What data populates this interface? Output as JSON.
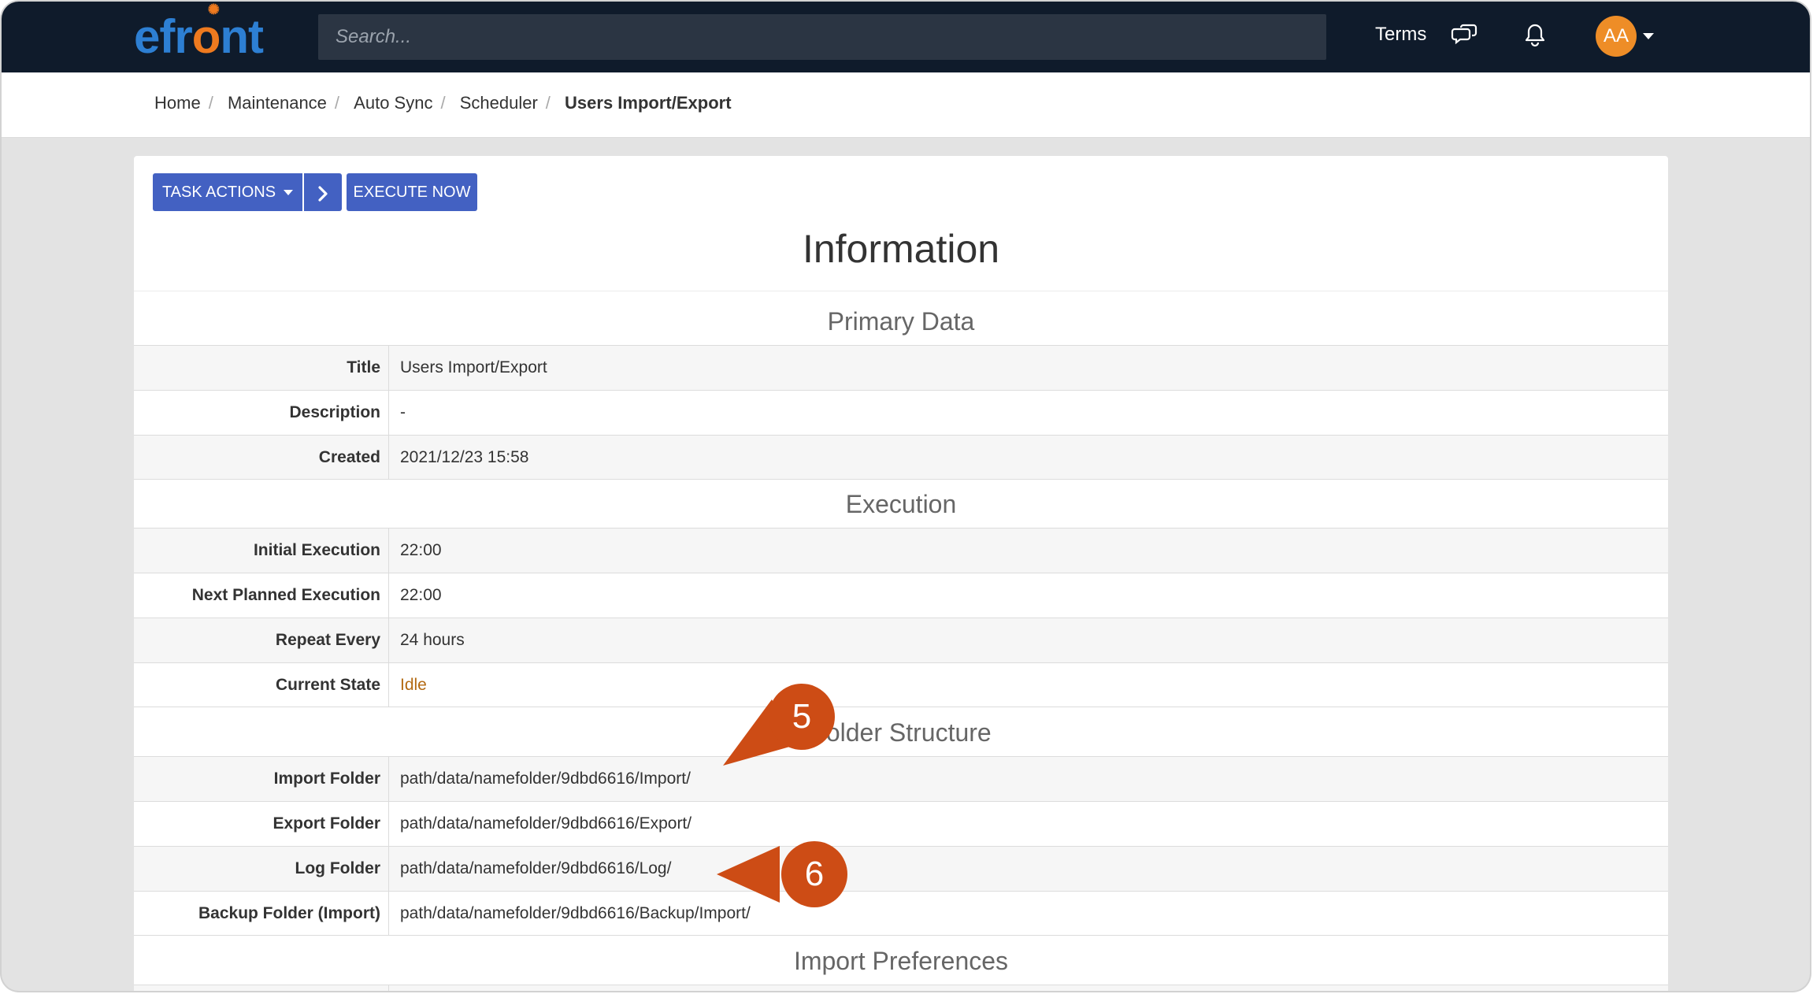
{
  "header": {
    "logo": "efront",
    "search_placeholder": "Search...",
    "terms_label": "Terms",
    "chat_icon": "chat-bubbles-icon",
    "bell_icon": "bell-icon",
    "avatar_initials": "AA"
  },
  "breadcrumb": [
    "Home",
    "Maintenance",
    "Auto Sync",
    "Scheduler",
    "Users Import/Export"
  ],
  "toolbar": {
    "task_actions_label": "TASK ACTIONS",
    "next_label": "›",
    "execute_now_label": "EXECUTE NOW"
  },
  "page_title": "Information",
  "sections": {
    "primary": {
      "heading": "Primary Data",
      "rows": [
        {
          "label": "Title",
          "value": "Users Import/Export"
        },
        {
          "label": "Description",
          "value": "-"
        },
        {
          "label": "Created",
          "value": "2021/12/23 15:58"
        }
      ]
    },
    "execution": {
      "heading": "Execution",
      "rows": [
        {
          "label": "Initial Execution",
          "value": "22:00"
        },
        {
          "label": "Next Planned Execution",
          "value": "22:00"
        },
        {
          "label": "Repeat Every",
          "value": "24 hours"
        },
        {
          "label": "Current State",
          "value": "Idle"
        }
      ]
    },
    "folders": {
      "heading": "Folder Structure",
      "rows": [
        {
          "label": "Import Folder",
          "value": "path/data/namefolder/9dbd6616/Import/"
        },
        {
          "label": "Export Folder",
          "value": "path/data/namefolder/9dbd6616/Export/"
        },
        {
          "label": "Log Folder",
          "value": "path/data/namefolder/9dbd6616/Log/"
        },
        {
          "label": "Backup Folder (Import)",
          "value": "path/data/namefolder/9dbd6616/Backup/Import/"
        }
      ]
    },
    "import_prefs": {
      "heading": "Import Preferences"
    }
  },
  "callouts": [
    "5",
    "6"
  ],
  "colors": {
    "topbar": "#0f1b2b",
    "button": "#4361c2",
    "callout": "#cd4c15",
    "idle": "#b36a12",
    "avatar": "#ee8d27"
  }
}
